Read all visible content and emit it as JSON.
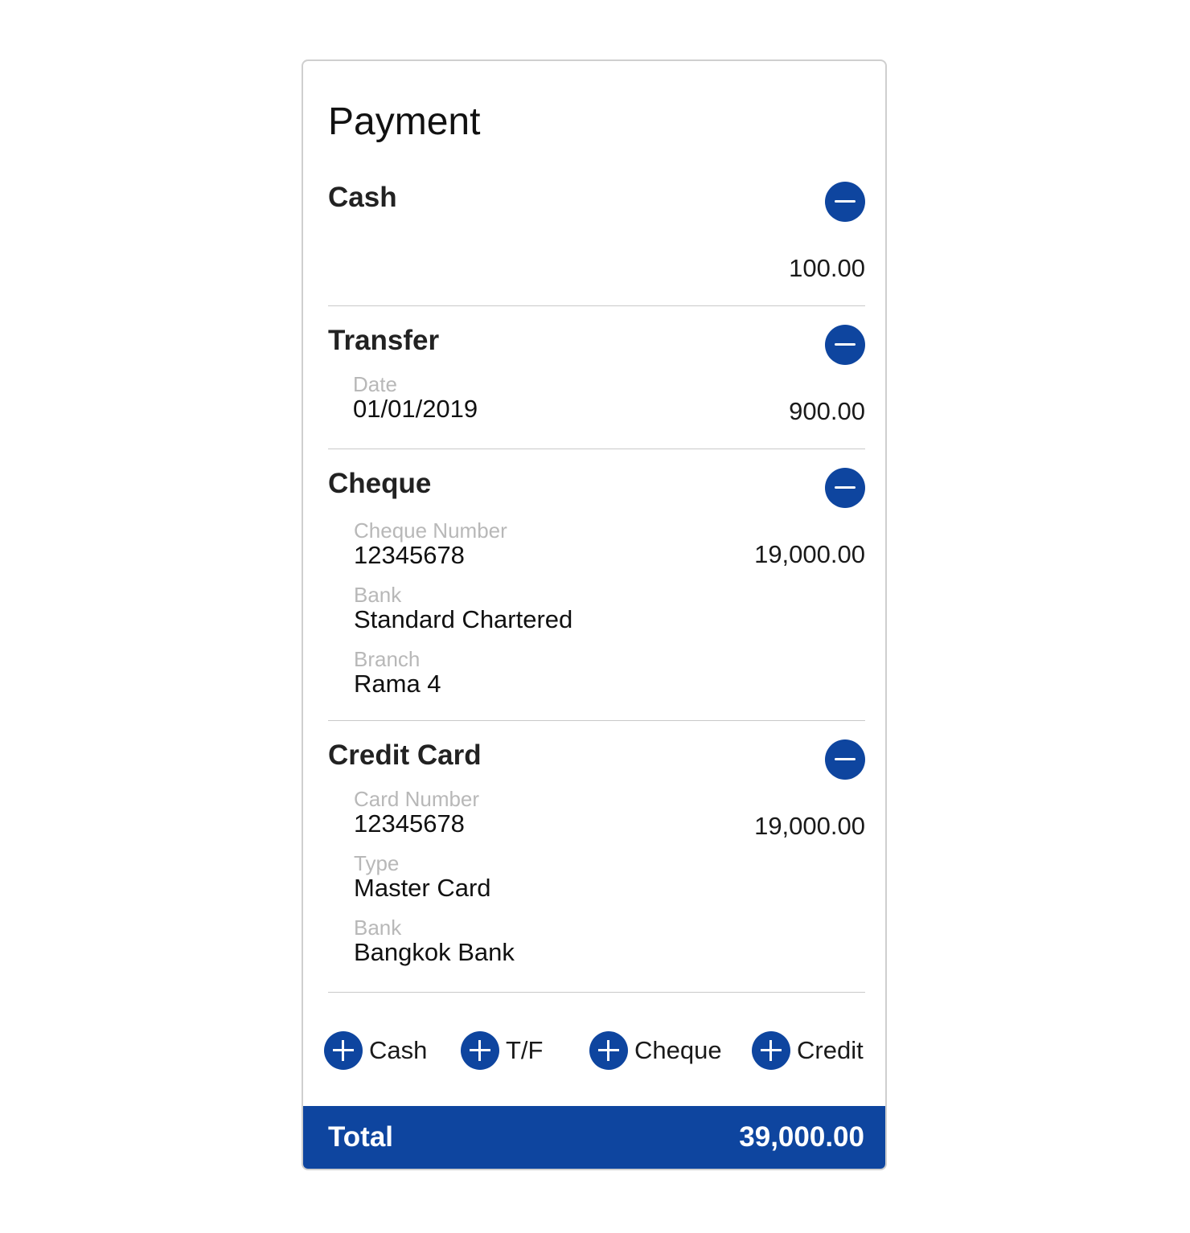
{
  "title": "Payment",
  "colors": {
    "accent": "#0e459f",
    "label": "#b8b8b8",
    "divider": "#c9c9c9"
  },
  "cash": {
    "title": "Cash",
    "amount": "100.00",
    "remove_icon": "minus-circle-icon"
  },
  "transfer": {
    "title": "Transfer",
    "date_label": "Date",
    "date_value": "01/01/2019",
    "amount": "900.00",
    "remove_icon": "minus-circle-icon"
  },
  "cheque": {
    "title": "Cheque",
    "number_label": "Cheque Number",
    "number_value": "12345678",
    "bank_label": "Bank",
    "bank_value": "Standard Chartered",
    "branch_label": "Branch",
    "branch_value": "Rama 4",
    "amount": "19,000.00",
    "remove_icon": "minus-circle-icon"
  },
  "credit_card": {
    "title": "Credit Card",
    "number_label": "Card Number",
    "number_value": "12345678",
    "type_label": "Type",
    "type_value": "Master Card",
    "bank_label": "Bank",
    "bank_value": "Bangkok Bank",
    "amount": "19,000.00",
    "remove_icon": "minus-circle-icon"
  },
  "add_buttons": {
    "icon": "plus-circle-icon",
    "cash": "Cash",
    "transfer": "T/F",
    "cheque": "Cheque",
    "credit": "Credit"
  },
  "total": {
    "label": "Total",
    "value": "39,000.00"
  }
}
